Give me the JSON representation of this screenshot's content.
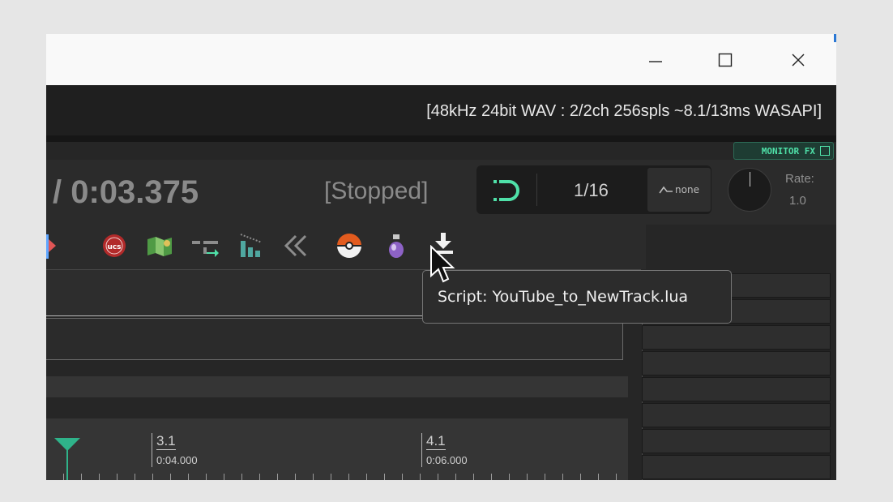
{
  "window": {
    "controls": {
      "minimize": "minimize-icon",
      "maximize": "maximize-icon",
      "close": "close-icon"
    }
  },
  "status": {
    "audio_device_info": "[48kHz 24bit WAV : 2/2ch 256spls ~8.1/13ms WASAPI]"
  },
  "monitor_fx": {
    "label": "MONITOR FX"
  },
  "transport": {
    "time": "/ 0:03.375",
    "play_state": "[Stopped]",
    "grid_division": "1/16",
    "swing_label": "none",
    "rate_label": "Rate:",
    "rate_value": "1.0"
  },
  "toolbar": {
    "icons": [
      "ucs-icon",
      "map-icon",
      "routing-icon",
      "bars-icon",
      "rewind-icon",
      "pokeball-icon",
      "potion-icon",
      "download-track-icon"
    ]
  },
  "ruler": {
    "markers": [
      {
        "bar": "3.1",
        "time": "0:04.000"
      },
      {
        "bar": "4.1",
        "time": "0:06.000"
      }
    ]
  },
  "tooltip": {
    "text": "Script: YouTube_to_NewTrack.lua"
  },
  "colors": {
    "accent_teal": "#4fe0a8",
    "background_dark": "#262626",
    "tooltip_bg": "#2c2c2c"
  }
}
